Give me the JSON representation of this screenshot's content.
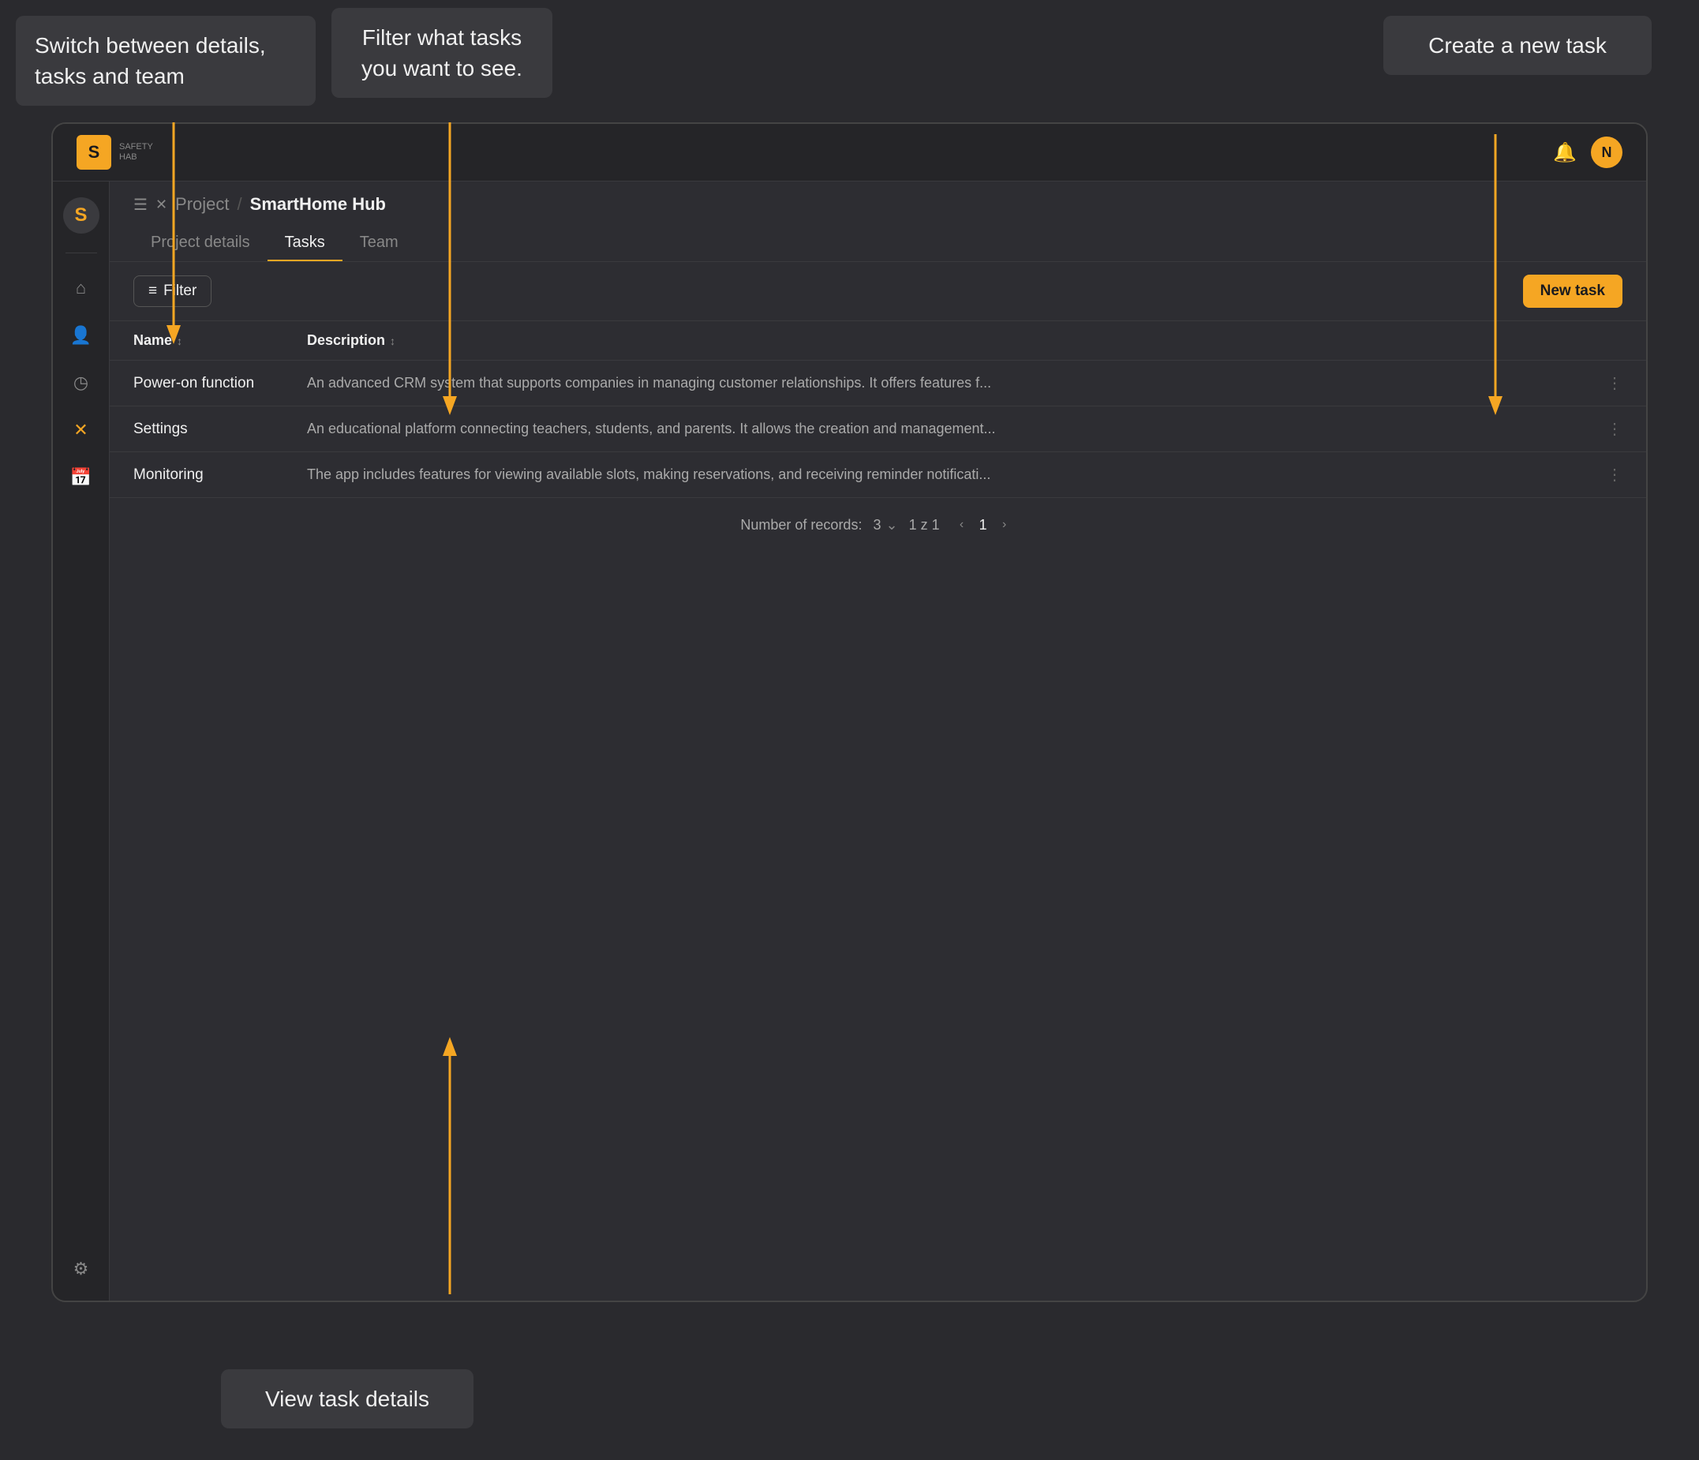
{
  "tooltips": {
    "top_left": {
      "text": "Switch between details, tasks and team"
    },
    "top_center": {
      "text": "Filter what tasks you want to see."
    },
    "top_right": {
      "text": "Create a new task"
    },
    "bottom_center": {
      "text": "View task details"
    }
  },
  "header": {
    "logo_letter": "S",
    "app_name": "SAFETY",
    "app_sub": "HAB",
    "bell_icon": "🔔",
    "avatar_letter": "N"
  },
  "breadcrumb": {
    "menu_icon": "☰",
    "project_icon": "✕",
    "project_label": "Project",
    "separator": "/",
    "current": "SmartHome Hub"
  },
  "tabs": [
    {
      "label": "Project details",
      "active": false
    },
    {
      "label": "Tasks",
      "active": true
    },
    {
      "label": "Team",
      "active": false
    }
  ],
  "toolbar": {
    "filter_label": "Filter",
    "filter_icon": "≡",
    "new_task_label": "New task"
  },
  "table": {
    "headers": [
      {
        "label": "Name",
        "sort": true
      },
      {
        "label": "Description",
        "sort": true
      }
    ],
    "rows": [
      {
        "name": "Power-on function",
        "description": "An advanced CRM system that supports companies in managing customer relationships. It offers features f..."
      },
      {
        "name": "Settings",
        "description": "An educational platform connecting teachers, students, and parents. It allows the creation and management..."
      },
      {
        "name": "Monitoring",
        "description": "The app includes features for viewing available slots, making reservations, and receiving reminder notificati..."
      }
    ]
  },
  "pagination": {
    "label": "Number of records:",
    "count": "3",
    "range": "1 z 1",
    "page": "1"
  },
  "sidebar": {
    "logo": "S",
    "nav_icons": [
      {
        "icon": "⌂",
        "label": "home",
        "active": false
      },
      {
        "icon": "👤",
        "label": "team",
        "active": false
      },
      {
        "icon": "⏱",
        "label": "time",
        "active": false
      },
      {
        "icon": "✕",
        "label": "project",
        "active": true
      },
      {
        "icon": "📅",
        "label": "calendar",
        "active": false
      }
    ],
    "bottom_icons": [
      {
        "icon": "⚙",
        "label": "settings"
      }
    ]
  }
}
